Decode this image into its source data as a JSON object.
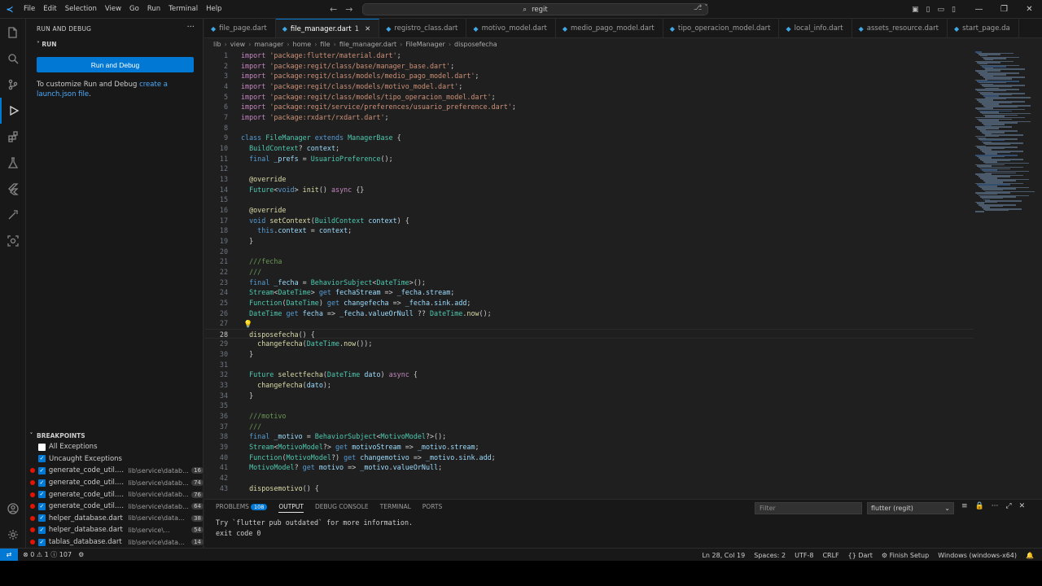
{
  "menu": [
    "File",
    "Edit",
    "Selection",
    "View",
    "Go",
    "Run",
    "Terminal",
    "Help"
  ],
  "search": {
    "text": "regit"
  },
  "sidebar": {
    "title": "RUN AND DEBUG",
    "section": "RUN",
    "run_button": "Run and Debug",
    "hint_prefix": "To customize Run and Debug",
    "hint_link": "create a launch.json file",
    "hint_suffix": ".",
    "breakpoints_title": "BREAKPOINTS",
    "breakpoints": [
      {
        "file": "All Exceptions",
        "path": "",
        "line": "",
        "dot": false,
        "checked": false
      },
      {
        "file": "Uncaught Exceptions",
        "path": "",
        "line": "",
        "dot": false,
        "checked": true
      },
      {
        "file": "generate_code_util.dart",
        "path": "lib\\service\\datab...",
        "line": "16",
        "dot": true,
        "checked": true
      },
      {
        "file": "generate_code_util.dart",
        "path": "lib\\service\\datab...",
        "line": "74",
        "dot": true,
        "checked": true
      },
      {
        "file": "generate_code_util.dart",
        "path": "lib\\service\\datab...",
        "line": "76",
        "dot": true,
        "checked": true
      },
      {
        "file": "generate_code_util.dart",
        "path": "lib\\service\\datab...",
        "line": "64",
        "dot": true,
        "checked": true
      },
      {
        "file": "helper_database.dart",
        "path": "lib\\service\\database",
        "line": "38",
        "dot": true,
        "checked": true
      },
      {
        "file": "helper_database.dart",
        "path": "lib\\service\\...",
        "line": "54",
        "dot": true,
        "checked": true
      },
      {
        "file": "tablas_database.dart",
        "path": "lib\\service\\database",
        "line": "14",
        "dot": true,
        "checked": true
      }
    ]
  },
  "tabs": [
    {
      "label": "file_page.dart",
      "active": false,
      "badge": ""
    },
    {
      "label": "file_manager.dart",
      "active": true,
      "badge": "1"
    },
    {
      "label": "registro_class.dart",
      "active": false,
      "badge": ""
    },
    {
      "label": "motivo_model.dart",
      "active": false,
      "badge": ""
    },
    {
      "label": "medio_pago_model.dart",
      "active": false,
      "badge": ""
    },
    {
      "label": "tipo_operacion_model.dart",
      "active": false,
      "badge": ""
    },
    {
      "label": "local_info.dart",
      "active": false,
      "badge": ""
    },
    {
      "label": "assets_resource.dart",
      "active": false,
      "badge": ""
    },
    {
      "label": "start_page.da",
      "active": false,
      "badge": ""
    }
  ],
  "breadcrumb": [
    "lib",
    "view",
    "manager",
    "home",
    "file",
    "file_manager.dart",
    "FileManager",
    "disposefecha"
  ],
  "editor": {
    "current_line": 28,
    "lines": [
      "import 'package:flutter/material.dart';",
      "import 'package:regit/class/base/manager_base.dart';",
      "import 'package:regit/class/models/medio_pago_model.dart';",
      "import 'package:regit/class/models/motivo_model.dart';",
      "import 'package:regit/class/models/tipo_operacion_model.dart';",
      "import 'package:regit/service/preferences/usuario_preference.dart';",
      "import 'package:rxdart/rxdart.dart';",
      "",
      "class FileManager extends ManagerBase {",
      "  BuildContext? context;",
      "  final _prefs = UsuarioPreference();",
      "",
      "  @override",
      "  Future<void> init() async {}",
      "",
      "  @override",
      "  void setContext(BuildContext context) {",
      "    this.context = context;",
      "  }",
      "",
      "  ///fecha",
      "  ///",
      "  final _fecha = BehaviorSubject<DateTime>();",
      "  Stream<DateTime> get fechaStream => _fecha.stream;",
      "  Function(DateTime) get changefecha => _fecha.sink.add;",
      "  DateTime get fecha => _fecha.valueOrNull ?? DateTime.now();",
      "",
      "  disposefecha() {",
      "    changefecha(DateTime.now());",
      "  }",
      "",
      "  Future selectfecha(DateTime dato) async {",
      "    changefecha(dato);",
      "  }",
      "",
      "  ///motivo",
      "  ///",
      "  final _motivo = BehaviorSubject<MotivoModel?>();",
      "  Stream<MotivoModel?> get motivoStream => _motivo.stream;",
      "  Function(MotivoModel?) get changemotivo => _motivo.sink.add;",
      "  MotivoModel? get motivo => _motivo.valueOrNull;",
      "",
      "  disposemotivo() {"
    ]
  },
  "panel": {
    "tabs": [
      "PROBLEMS",
      "OUTPUT",
      "DEBUG CONSOLE",
      "TERMINAL",
      "PORTS"
    ],
    "problems_count": "108",
    "active_tab": "OUTPUT",
    "filter_placeholder": "Filter",
    "channel": "flutter (regit)",
    "output_lines": [
      "Try `flutter pub outdated` for more information.",
      "exit code 0"
    ]
  },
  "status": {
    "errors": "0",
    "warnings": "1",
    "info": "107",
    "position": "Ln 28, Col 19",
    "spaces": "Spaces: 2",
    "encoding": "UTF-8",
    "eol": "CRLF",
    "language": "Dart",
    "finish_setup": "Finish Setup",
    "platform": "Windows (windows-x64)"
  }
}
